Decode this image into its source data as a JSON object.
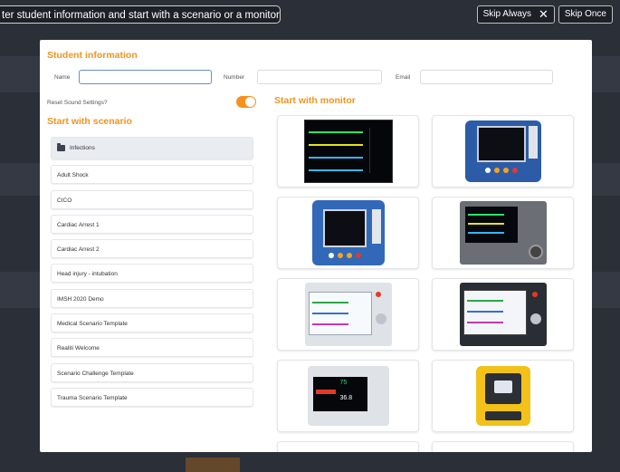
{
  "banner": {
    "tip_text": "ter student information and start with a scenario or a monitor",
    "skip_always": "Skip Always",
    "skip_once": "Skip Once"
  },
  "student": {
    "title": "Student information",
    "name_label": "Name",
    "name_value": "",
    "number_label": "Number",
    "number_value": "",
    "email_label": "Email",
    "email_value": ""
  },
  "sound": {
    "label": "Reset Sound Settings?",
    "enabled": true
  },
  "scenario": {
    "title": "Start with scenario",
    "folder": "Infections",
    "items": [
      "Adult Shock",
      "CICO",
      "Cardiac Arrest 1",
      "Cardiac Arrest 2",
      "Head injury - intubation",
      "IMSH 2020 Demo",
      "Medical Scenario Template",
      "Realiti Welcome",
      "Scenario Challenge Template",
      "Trauma Scenario Template"
    ]
  },
  "monitor": {
    "title": "Start with monitor",
    "devices": [
      "monitor-black-icon",
      "monitor-blue-icon",
      "monitor-blue-2-icon",
      "monitor-grey-icon",
      "monitor-white-icon",
      "monitor-dark-icon",
      "monitor-small-icon",
      "aed-icon"
    ],
    "texts": {
      "m7_value_a": "75",
      "m7_value_b": "36.8"
    }
  },
  "colors": {
    "accent": "#f5921e",
    "overlay": "#2b2f38"
  }
}
